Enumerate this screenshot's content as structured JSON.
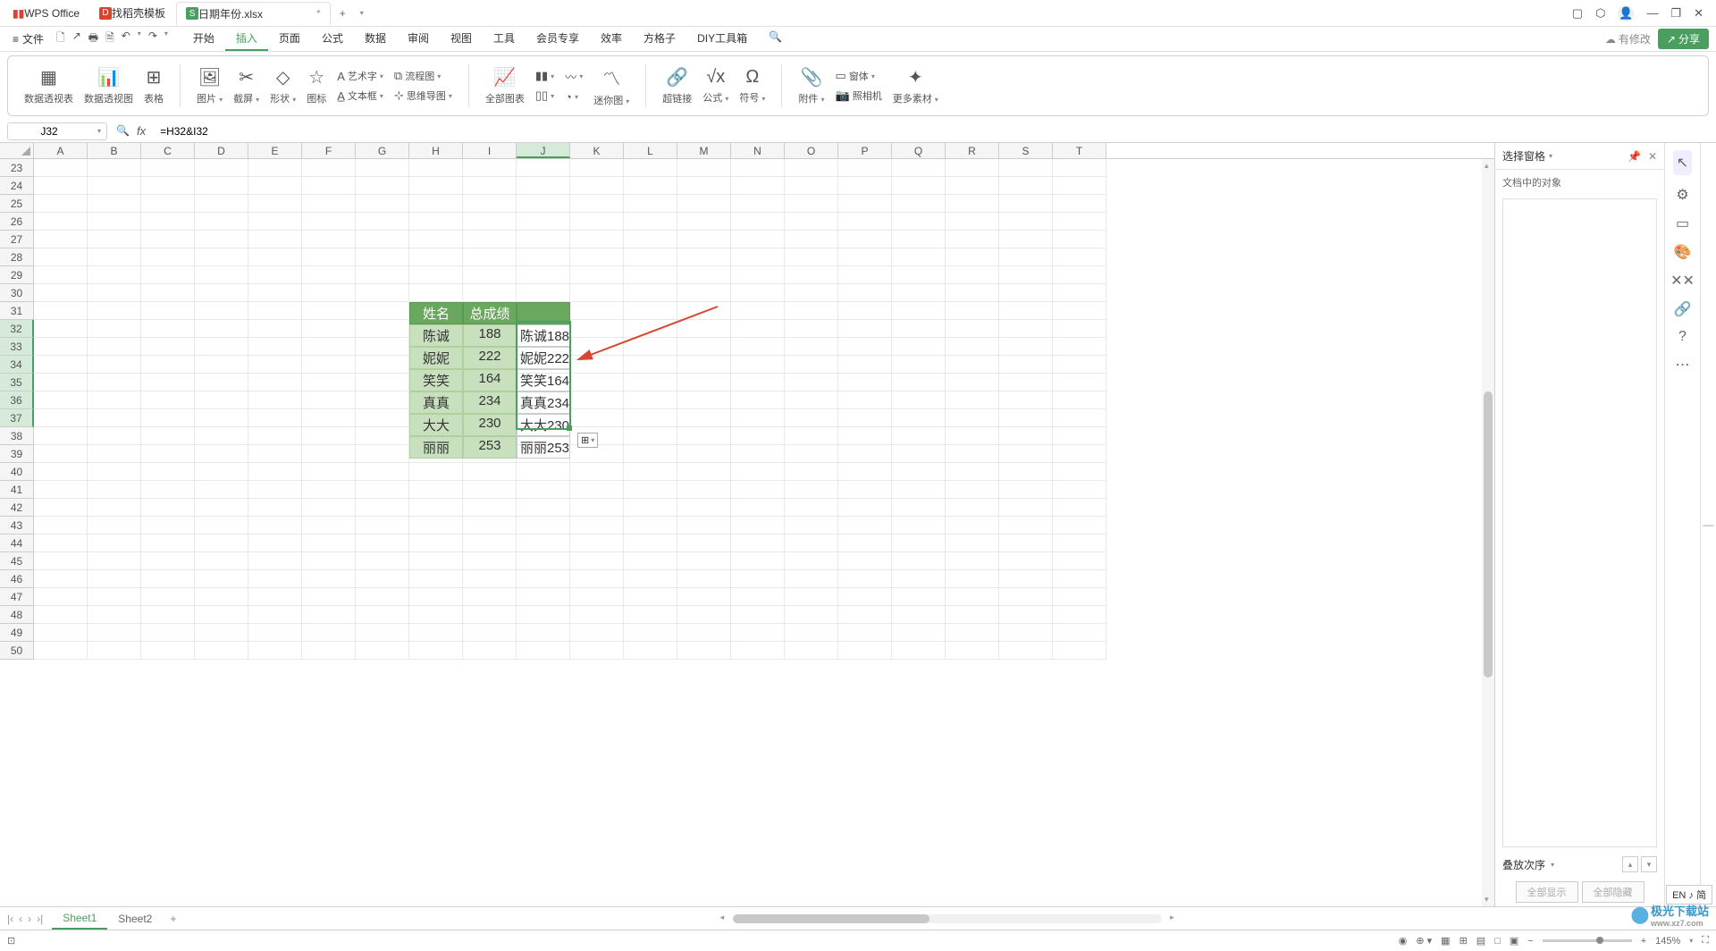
{
  "titlebar": {
    "app_name": "WPS Office",
    "tabs": [
      {
        "icon": "D",
        "label": "找稻壳模板"
      },
      {
        "icon": "S",
        "label": "日期年份.xlsx",
        "modified": "*"
      }
    ],
    "controls": [
      "▢",
      "⬡",
      "👤",
      "—",
      "❐",
      "✕"
    ]
  },
  "menubar": {
    "menu_icon": "≡",
    "file_label": "文件",
    "quick_icons": [
      "save",
      "export",
      "print",
      "preview",
      "undo",
      "redo",
      "more"
    ],
    "tabs": [
      "开始",
      "插入",
      "页面",
      "公式",
      "数据",
      "审阅",
      "视图",
      "工具",
      "会员专享",
      "效率",
      "方格子",
      "DIY工具箱"
    ],
    "active_tab": "插入",
    "search_icon": "🔍",
    "modify_note": "有修改",
    "share_label": "分享"
  },
  "ribbon": {
    "items": [
      {
        "label": "数据透视表"
      },
      {
        "label": "数据透视图"
      },
      {
        "label": "表格"
      },
      {
        "label": "图片",
        "dd": true
      },
      {
        "label": "截屏",
        "dd": true
      },
      {
        "label": "形状",
        "dd": true
      },
      {
        "label": "图标"
      },
      {
        "sm": [
          {
            "label": "艺术字",
            "dd": true
          },
          {
            "label": "文本框",
            "dd": true
          }
        ]
      },
      {
        "sm": [
          {
            "label": "流程图",
            "dd": true
          },
          {
            "label": "思维导图",
            "dd": true
          }
        ]
      },
      {
        "label": "全部图表"
      },
      {
        "col": true
      },
      {
        "col2": true
      },
      {
        "label": "迷你图",
        "dd": true
      },
      {
        "label": "超链接"
      },
      {
        "label": "公式",
        "dd": true
      },
      {
        "label": "符号",
        "dd": true
      },
      {
        "label": "附件",
        "dd": true
      },
      {
        "sm": [
          {
            "label": "窗体",
            "dd": true
          },
          {
            "label": "照相机"
          }
        ]
      },
      {
        "label": "更多素材",
        "dd": true
      }
    ]
  },
  "formula": {
    "name_box": "J32",
    "formula_value": "=H32&I32"
  },
  "spreadsheet": {
    "columns": [
      "A",
      "B",
      "C",
      "D",
      "E",
      "F",
      "G",
      "H",
      "I",
      "J",
      "K",
      "L",
      "M",
      "N",
      "O",
      "P",
      "Q",
      "R",
      "S",
      "T"
    ],
    "active_col": "J",
    "rows_start": 23,
    "rows_end": 50,
    "active_rows": [
      32,
      33,
      34,
      35,
      36,
      37
    ],
    "table": {
      "header": [
        "姓名",
        "总成绩"
      ],
      "rows": [
        {
          "name": "陈诚",
          "score": "188",
          "concat": "陈诚188"
        },
        {
          "name": "妮妮",
          "score": "222",
          "concat": "妮妮222"
        },
        {
          "name": "笑笑",
          "score": "164",
          "concat": "笑笑164"
        },
        {
          "name": "真真",
          "score": "234",
          "concat": "真真234"
        },
        {
          "name": "大大",
          "score": "230",
          "concat": "大大230"
        },
        {
          "name": "丽丽",
          "score": "253",
          "concat": "丽丽253"
        }
      ]
    },
    "fill_icon": "⊞"
  },
  "right_panel": {
    "title": "选择窗格",
    "sub": "文档中的对象",
    "order_label": "叠放次序",
    "show_all": "全部显示",
    "hide_all": "全部隐藏"
  },
  "sheets": {
    "tabs": [
      "Sheet1",
      "Sheet2"
    ],
    "active": "Sheet1"
  },
  "status": {
    "left_icon": "⊡",
    "zoom": "145%",
    "icons": [
      "◉",
      "⊕",
      "▦",
      "⊞",
      "▤",
      "□",
      "▣"
    ]
  },
  "lang_badge": "EN ♪ 简",
  "watermark": "极光下载站",
  "watermark_sub": "www.xz7.com"
}
